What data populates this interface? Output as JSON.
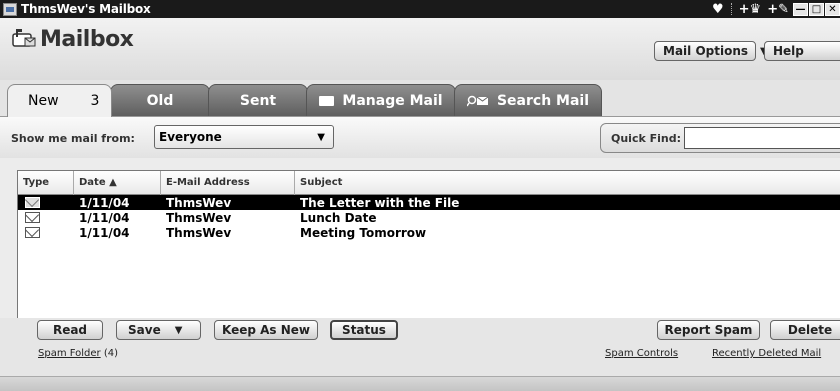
{
  "window": {
    "title": "ThmsWev's Mailbox"
  },
  "header": {
    "title": "Mailbox",
    "mail_options_label": "Mail Options",
    "help_label": "Help"
  },
  "tabs": {
    "new_label": "New",
    "new_count": "3",
    "old_label": "Old",
    "sent_label": "Sent",
    "manage_label": "Manage Mail",
    "search_label": "Search Mail"
  },
  "filter": {
    "show_label": "Show me mail from:",
    "selected": "Everyone",
    "quick_find_label": "Quick Find:",
    "quick_find_value": ""
  },
  "table": {
    "columns": [
      "Type",
      "Date ▲",
      "E-Mail Address",
      "Subject"
    ],
    "rows": [
      {
        "date": "1/11/04",
        "email": "ThmsWev",
        "subject": "The Letter with the File"
      },
      {
        "date": "1/11/04",
        "email": "ThmsWev",
        "subject": "Lunch Date"
      },
      {
        "date": "1/11/04",
        "email": "ThmsWev",
        "subject": "Meeting Tomorrow"
      }
    ]
  },
  "actions": {
    "read": "Read",
    "save": "Save",
    "keep_as_new": "Keep As New",
    "status": "Status",
    "report_spam": "Report Spam",
    "delete": "Delete"
  },
  "links": {
    "spam_folder": "Spam Folder",
    "spam_folder_count": "(4)",
    "spam_controls": "Spam Controls",
    "recently_deleted": "Recently Deleted Mail"
  },
  "colors": {
    "selected_row": "#000000",
    "tab_dark": "#6e6e6e",
    "background": "#e4e4e4"
  }
}
